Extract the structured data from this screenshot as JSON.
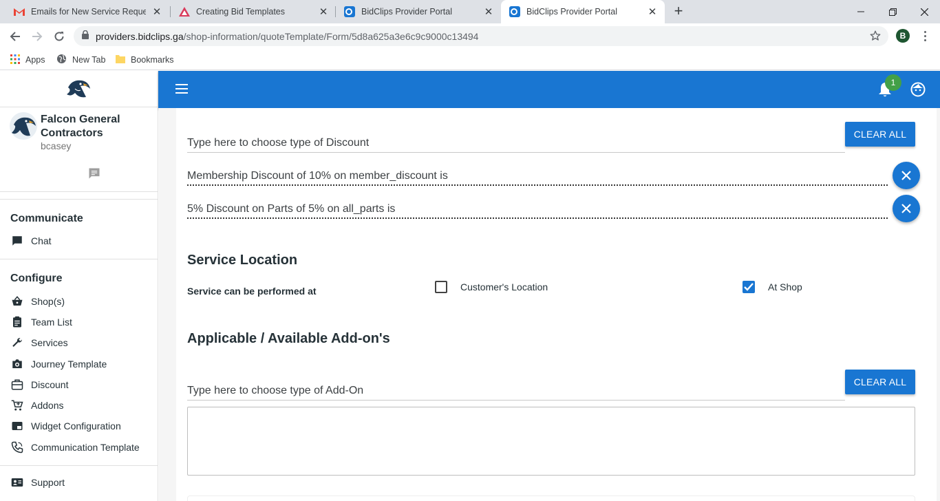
{
  "browser": {
    "tabs": [
      {
        "title": "Emails for New Service Requests",
        "icon": "gmail-icon"
      },
      {
        "title": "Creating Bid Templates",
        "icon": "bid-templates-icon"
      },
      {
        "title": "BidClips Provider Portal",
        "icon": "bidclips-icon"
      },
      {
        "title": "BidClips Provider Portal",
        "icon": "bidclips-icon",
        "active": true
      }
    ],
    "url_host": "providers.bidclips.ga",
    "url_path": "/shop-information/quoteTemplate/Form/5d8a625a3e6c9c9000c13494",
    "profile_initial": "B",
    "bookmarks": [
      "Apps",
      "New Tab",
      "Bookmarks"
    ]
  },
  "header": {
    "notification_count": "1",
    "accent_color": "#1976d2",
    "badge_color": "#43a047"
  },
  "sidebar": {
    "org_name": "Falcon General Contractors",
    "username": "bcasey",
    "sections": [
      {
        "title": "Communicate",
        "items": [
          {
            "label": "Chat",
            "icon": "chat-icon"
          }
        ]
      },
      {
        "title": "Configure",
        "items": [
          {
            "label": "Shop(s)",
            "icon": "shop-basket-icon"
          },
          {
            "label": "Team List",
            "icon": "clipboard-icon"
          },
          {
            "label": "Services",
            "icon": "wrench-icon"
          },
          {
            "label": "Journey Template",
            "icon": "camera-icon"
          },
          {
            "label": "Discount",
            "icon": "briefcase-icon"
          },
          {
            "label": "Addons",
            "icon": "cart-plus-icon"
          },
          {
            "label": "Widget Configuration",
            "icon": "widget-icon"
          },
          {
            "label": "Communication Template",
            "icon": "phone-icon"
          }
        ]
      }
    ],
    "support": {
      "label": "Support",
      "icon": "contact-card-icon"
    }
  },
  "main": {
    "discount": {
      "placeholder": "Type here to choose type of Discount",
      "clear_label": "CLEAR ALL",
      "selected": [
        "Membership Discount of 10% on member_discount is",
        "5%  Discount on Parts of 5% on all_parts is"
      ]
    },
    "service_location": {
      "heading": "Service Location",
      "label": "Service can be performed at",
      "options": [
        {
          "label": "Customer's Location",
          "checked": false
        },
        {
          "label": "At Shop",
          "checked": true
        }
      ]
    },
    "addons": {
      "heading": "Applicable / Available Add-on's",
      "placeholder": "Type here to choose type of Add-On",
      "clear_label": "CLEAR ALL"
    }
  }
}
